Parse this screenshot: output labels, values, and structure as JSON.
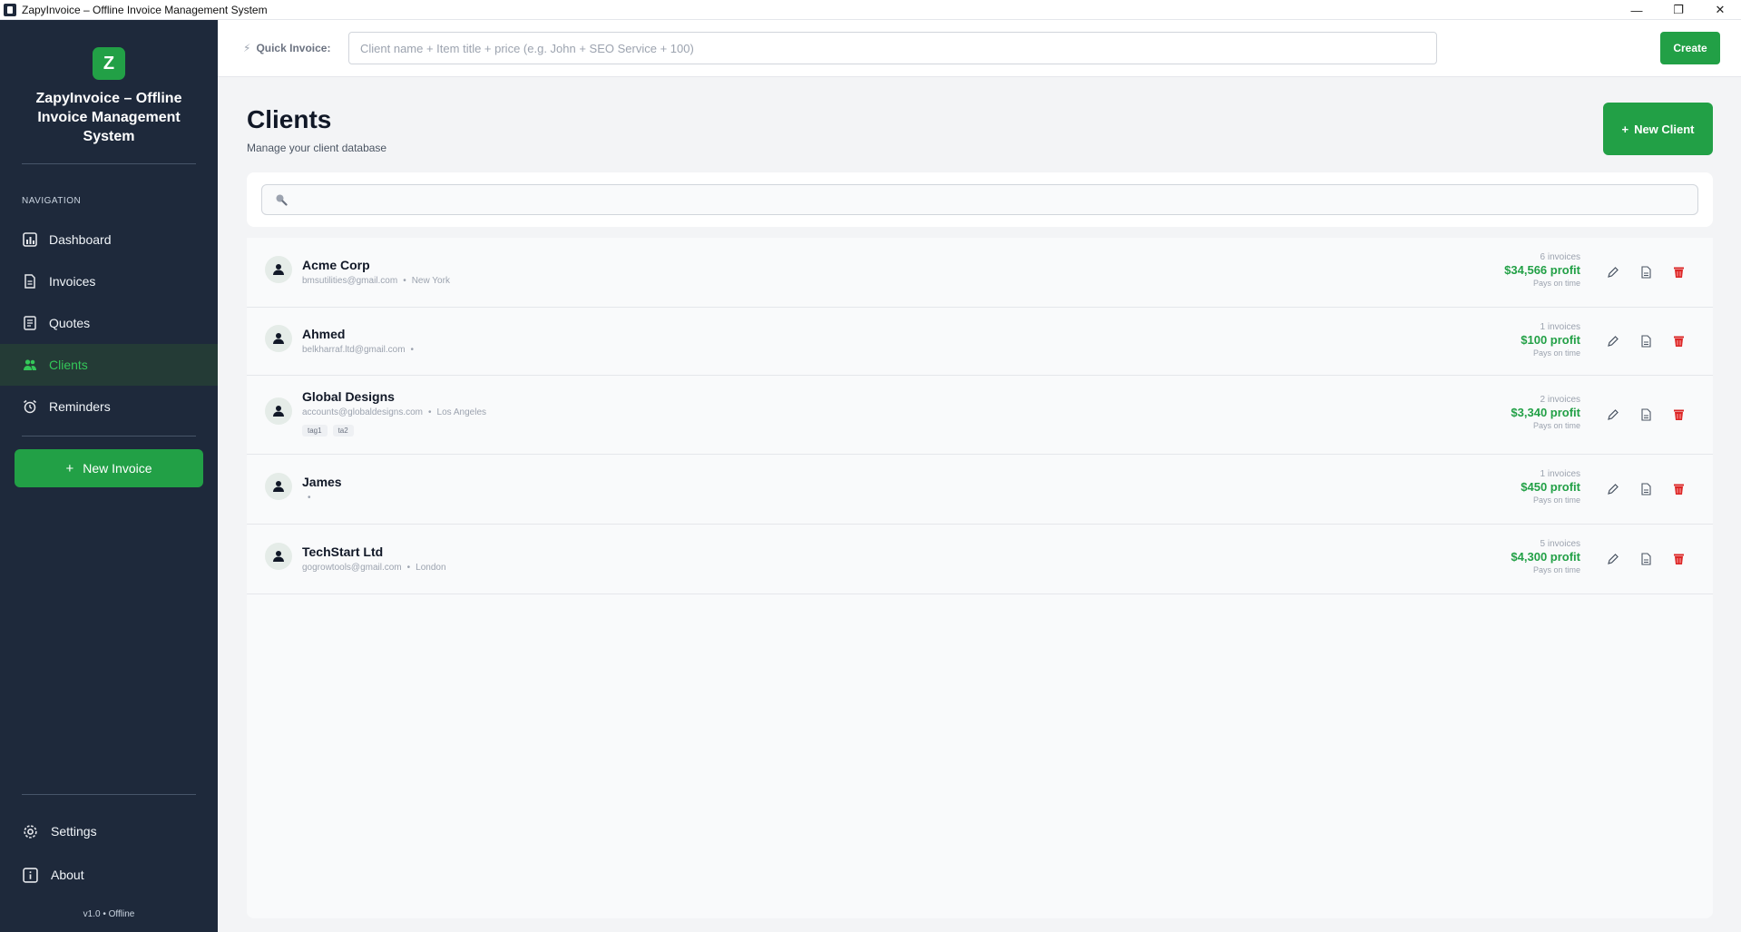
{
  "window": {
    "title": "ZapyInvoice – Offline Invoice Management System",
    "minimize": "—",
    "maximize": "❐",
    "close": "✕"
  },
  "sidebar": {
    "logo_letter": "Z",
    "brand": "ZapyInvoice – Offline Invoice Management System",
    "nav_heading": "NAVIGATION",
    "items": [
      {
        "label": "Dashboard",
        "icon": "dashboard-icon"
      },
      {
        "label": "Invoices",
        "icon": "invoice-icon"
      },
      {
        "label": "Quotes",
        "icon": "quote-icon"
      },
      {
        "label": "Clients",
        "icon": "users-icon",
        "active": true
      },
      {
        "label": "Reminders",
        "icon": "alarm-icon"
      }
    ],
    "new_invoice_label": "New Invoice",
    "settings_label": "Settings",
    "about_label": "About",
    "version": "v1.0 • Offline"
  },
  "quick_invoice": {
    "label": "Quick Invoice:",
    "placeholder": "Client name + Item title + price (e.g. John + SEO Service + 100)",
    "value": "",
    "create_label": "Create"
  },
  "page": {
    "title": "Clients",
    "subtitle": "Manage your client database",
    "new_client_label": "New Client"
  },
  "search": {
    "placeholder": "",
    "value": ""
  },
  "clients": [
    {
      "name": "Acme Corp",
      "email": "bmsutilities@gmail.com",
      "location": "New York",
      "tags": [],
      "invoices": "6 invoices",
      "profit": "$34,566 profit",
      "status": "Pays on time"
    },
    {
      "name": "Ahmed",
      "email": "belkharraf.ltd@gmail.com",
      "location": "",
      "tags": [],
      "invoices": "1 invoices",
      "profit": "$100 profit",
      "status": "Pays on time"
    },
    {
      "name": "Global Designs",
      "email": "accounts@globaldesigns.com",
      "location": "Los Angeles",
      "tags": [
        "tag1",
        "ta2"
      ],
      "invoices": "2 invoices",
      "profit": "$3,340 profit",
      "status": "Pays on time"
    },
    {
      "name": "James",
      "email": "",
      "location": "",
      "tags": [],
      "invoices": "1 invoices",
      "profit": "$450 profit",
      "status": "Pays on time"
    },
    {
      "name": "TechStart Ltd",
      "email": "gogrowtools@gmail.com",
      "location": "London",
      "tags": [],
      "invoices": "5 invoices",
      "profit": "$4,300 profit",
      "status": "Pays on time"
    }
  ],
  "colors": {
    "sidebar_bg": "#1e293b",
    "accent": "#22a046",
    "danger": "#dc2626"
  }
}
